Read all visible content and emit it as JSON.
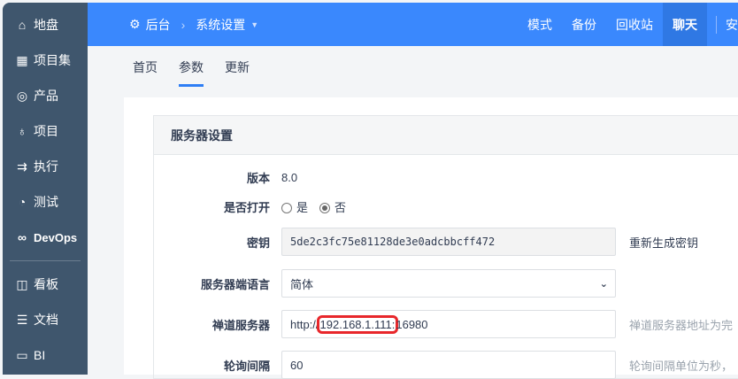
{
  "sidebar": {
    "items": [
      {
        "icon": "home-icon",
        "label": "地盘"
      },
      {
        "icon": "grid-icon",
        "label": "项目集"
      },
      {
        "icon": "bulb-icon",
        "label": "产品"
      },
      {
        "icon": "rocket-icon",
        "label": "项目"
      },
      {
        "icon": "run-icon",
        "label": "执行"
      },
      {
        "icon": "test-icon",
        "label": "测试"
      },
      {
        "icon": "infinity-icon",
        "label": "DevOps"
      },
      {
        "icon": "kanban-icon",
        "label": "看板"
      },
      {
        "icon": "doc-icon",
        "label": "文档"
      },
      {
        "icon": "chart-icon",
        "label": "BI"
      }
    ]
  },
  "topbar": {
    "crumb1": "后台",
    "crumb2": "系统设置",
    "nav": [
      "模式",
      "备份",
      "回收站",
      "聊天"
    ],
    "nav_active": "聊天",
    "nav_cut": "安"
  },
  "tabs": [
    "首页",
    "参数",
    "更新"
  ],
  "card": {
    "title": "服务器设置",
    "version_label": "版本",
    "version": "8.0",
    "open_label": "是否打开",
    "yes": "是",
    "no": "否",
    "key_label": "密钥",
    "key": "5de2c3fc75e81128de3e0adcbbcff472",
    "regen": "重新生成密钥",
    "lang_label": "服务器端语言",
    "lang": "简体",
    "server_label": "禅道服务器",
    "server_prefix": "http://",
    "server_host": "192.168.1.111:",
    "server_port": "16980",
    "server_hint": "禅道服务器地址为完",
    "poll_label": "轮询间隔",
    "poll": "60",
    "poll_hint": "轮询间隔单位为秒，"
  }
}
